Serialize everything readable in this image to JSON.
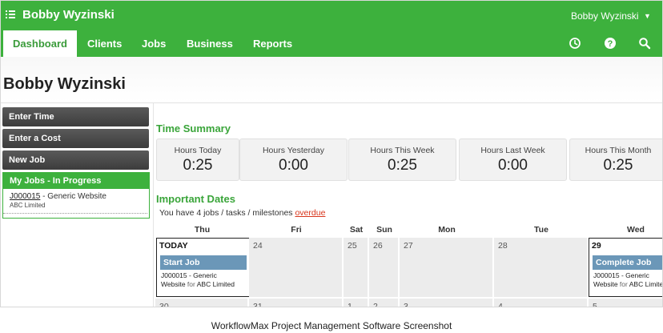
{
  "topbar": {
    "title": "Bobby Wyzinski",
    "user": "Bobby Wyzinski",
    "icons": [
      "menu-icon",
      "chevron-down-icon",
      "clock-icon",
      "help-icon",
      "search-icon"
    ]
  },
  "nav": {
    "tabs": [
      {
        "label": "Dashboard",
        "active": true
      },
      {
        "label": "Clients"
      },
      {
        "label": "Jobs"
      },
      {
        "label": "Business"
      },
      {
        "label": "Reports"
      }
    ]
  },
  "page": {
    "title": "Bobby Wyzinski"
  },
  "sidebar": {
    "buttons": [
      "Enter Time",
      "Enter a Cost",
      "New Job"
    ],
    "my_jobs": {
      "title": "My Jobs - In Progress",
      "jobs": [
        {
          "code": "J000015",
          "name": " - Generic Website",
          "client": "ABC Limited"
        }
      ]
    }
  },
  "time_summary": {
    "title": "Time Summary",
    "cards": [
      {
        "label": "Hours Today",
        "value": "0:25"
      },
      {
        "label": "Hours Yesterday",
        "value": "0:00"
      },
      {
        "label": "Hours This Week",
        "value": "0:25"
      },
      {
        "label": "Hours Last Week",
        "value": "0:00"
      },
      {
        "label": "Hours This Month",
        "value": "0:25"
      }
    ]
  },
  "important_dates": {
    "title": "Important Dates",
    "summary": "You have 4 jobs / tasks / milestones ",
    "overdue_link": "overdue",
    "days": [
      "Thu",
      "Fri",
      "Sat",
      "Sun",
      "Mon",
      "Tue",
      "Wed"
    ],
    "week1": [
      "TODAY",
      "24",
      "25",
      "26",
      "27",
      "28",
      "29"
    ],
    "week2": [
      "30",
      "31",
      "1",
      "2",
      "3",
      "4",
      "5"
    ],
    "events": [
      {
        "title": "Start Job",
        "line1": "J000015 - Generic",
        "line2a": "Website ",
        "line2b": "for",
        "line2c": " ABC Limited"
      },
      {
        "title": "Complete Job",
        "line1": "J000015 - Generic",
        "line2a": "Website ",
        "line2b": "for",
        "line2c": " ABC Limited"
      }
    ]
  },
  "caption": "WorkflowMax Project Management Software Screenshot",
  "colors": {
    "brand_green": "#3db13d",
    "event_blue": "#6b97b8",
    "overdue_red": "#d8351b"
  }
}
